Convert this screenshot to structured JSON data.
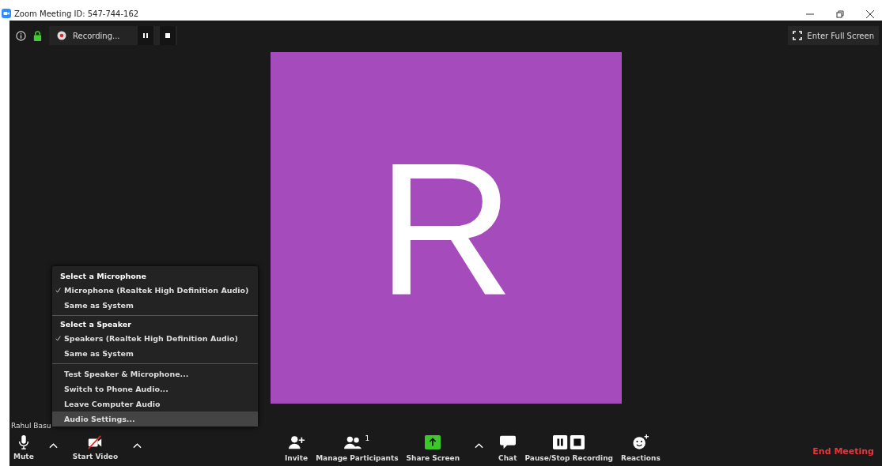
{
  "window": {
    "title": "Zoom Meeting ID: 547-744-162"
  },
  "top_bar": {
    "recording_label": "Recording...",
    "full_screen": "Enter Full Screen"
  },
  "video": {
    "initial": "R",
    "name": "Rahul Basu"
  },
  "audio_menu": {
    "sections": [
      {
        "heading": "Select a Microphone",
        "items": [
          {
            "label": "Microphone (Realtek High Definition Audio)",
            "checked": true
          },
          {
            "label": "Same as System",
            "checked": false
          }
        ]
      },
      {
        "heading": "Select a Speaker",
        "items": [
          {
            "label": "Speakers (Realtek High Definition Audio)",
            "checked": true
          },
          {
            "label": "Same as System",
            "checked": false
          }
        ]
      }
    ],
    "actions": [
      {
        "label": "Test Speaker & Microphone...",
        "selected": false
      },
      {
        "label": "Switch to Phone Audio...",
        "selected": false
      },
      {
        "label": "Leave Computer Audio",
        "selected": false
      },
      {
        "label": "Audio Settings...",
        "selected": true
      }
    ]
  },
  "toolbar": {
    "left": [
      {
        "kind": "mute",
        "label": "Mute",
        "caret": true
      },
      {
        "kind": "video",
        "label": "Start Video",
        "caret": true
      }
    ],
    "center": [
      {
        "kind": "invite",
        "label": "Invite",
        "caret": false
      },
      {
        "kind": "participants",
        "label": "Manage Participants",
        "count": "1",
        "caret": false
      },
      {
        "kind": "share",
        "label": "Share Screen",
        "caret": true
      },
      {
        "kind": "chat",
        "label": "Chat",
        "caret": false
      },
      {
        "kind": "recording",
        "label": "Pause/Stop Recording",
        "caret": false
      },
      {
        "kind": "reactions",
        "label": "Reactions",
        "caret": false
      }
    ],
    "end_button": "End Meeting"
  }
}
